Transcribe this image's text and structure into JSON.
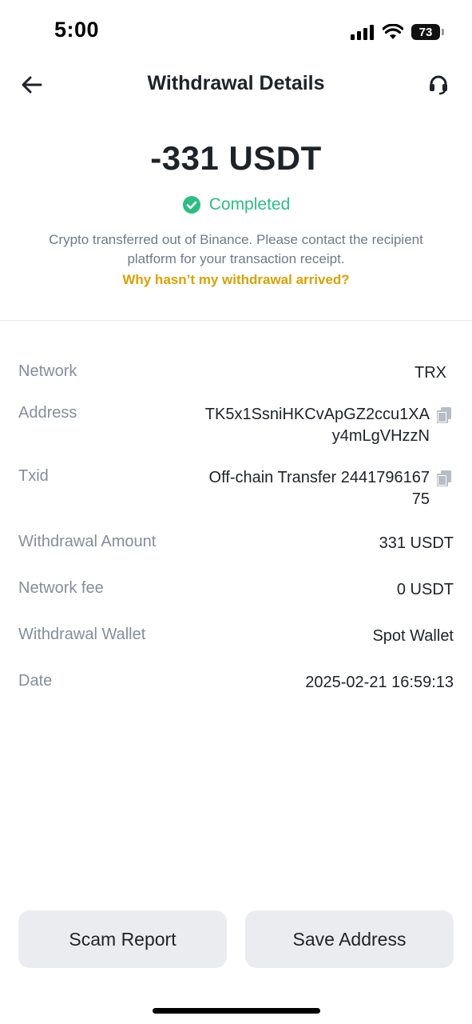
{
  "status_bar": {
    "time": "5:00",
    "battery": "73"
  },
  "header": {
    "title": "Withdrawal Details"
  },
  "summary": {
    "amount": "-331 USDT",
    "status": "Completed",
    "info": "Crypto transferred out of Binance. Please contact the recipient platform for your transaction receipt.",
    "help_link": "Why hasn’t my withdrawal arrived?"
  },
  "details": {
    "network": {
      "label": "Network",
      "value": "TRX"
    },
    "address": {
      "label": "Address",
      "line1": "TK5x1SsniHKCvApGZ2ccu1XA",
      "line2": "y4mLgVHzzN"
    },
    "txid": {
      "label": "Txid",
      "line1": "Off-chain Transfer 2441796167",
      "line2": "75"
    },
    "withdrawal_amount": {
      "label": "Withdrawal Amount",
      "value": "331 USDT"
    },
    "network_fee": {
      "label": "Network fee",
      "value": "0 USDT"
    },
    "withdrawal_wallet": {
      "label": "Withdrawal Wallet",
      "value": "Spot Wallet"
    },
    "date": {
      "label": "Date",
      "value": "2025-02-21 16:59:13"
    }
  },
  "buttons": {
    "scam_report": "Scam Report",
    "save_address": "Save Address"
  },
  "colors": {
    "success": "#2ebd85",
    "link": "#d8a200",
    "label": "#848e9c",
    "button_bg": "#eaecef"
  }
}
